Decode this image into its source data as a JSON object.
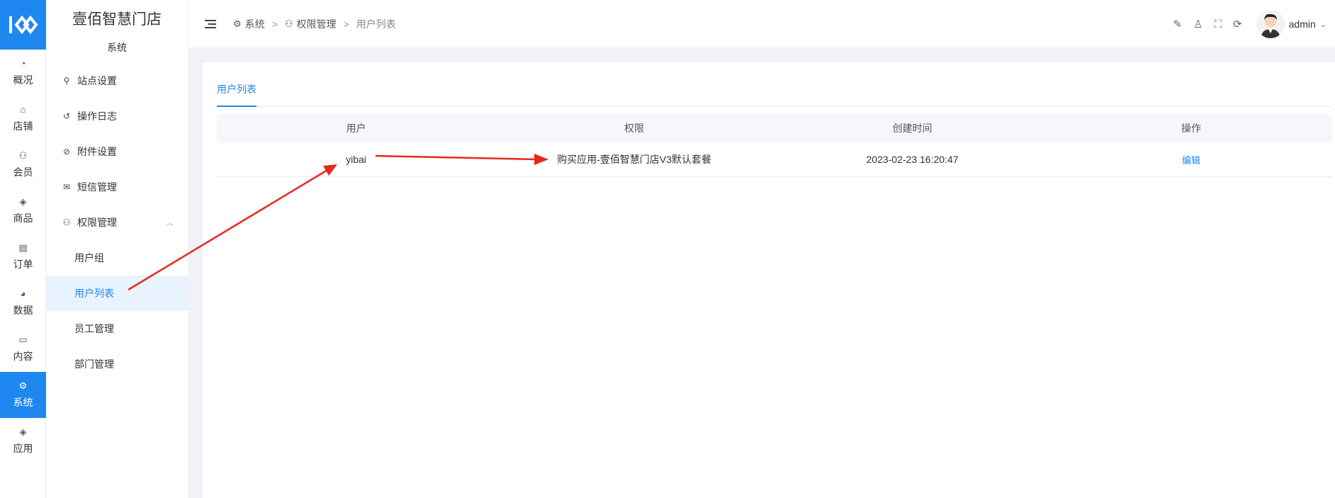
{
  "rail": {
    "items": [
      {
        "label": "概况",
        "icon": "dashboard-icon",
        "glyph": "◔"
      },
      {
        "label": "店铺",
        "icon": "store-icon",
        "glyph": "⌂"
      },
      {
        "label": "会员",
        "icon": "user-icon",
        "glyph": "⚇"
      },
      {
        "label": "商品",
        "icon": "box-icon",
        "glyph": "◈"
      },
      {
        "label": "订单",
        "icon": "clipboard-icon",
        "glyph": "▤"
      },
      {
        "label": "数据",
        "icon": "pie-chart-icon",
        "glyph": "◕"
      },
      {
        "label": "内容",
        "icon": "folder-icon",
        "glyph": "▭"
      },
      {
        "label": "系统",
        "icon": "gear-icon",
        "glyph": "⚙"
      },
      {
        "label": "应用",
        "icon": "cube-icon",
        "glyph": "◈"
      }
    ],
    "active": "系统",
    "accent": "#1e88f0"
  },
  "sidebar": {
    "brand": "壹佰智慧门店",
    "section": "系统",
    "items": [
      {
        "label": "站点设置",
        "icon": "sitemap-icon",
        "glyph": "⚲"
      },
      {
        "label": "操作日志",
        "icon": "history-icon",
        "glyph": "↺"
      },
      {
        "label": "附件设置",
        "icon": "paperclip-icon",
        "glyph": "⊘"
      },
      {
        "label": "短信管理",
        "icon": "mail-icon",
        "glyph": "✉"
      },
      {
        "label": "权限管理",
        "icon": "user-shield-icon",
        "glyph": "⚇"
      }
    ],
    "submenu": [
      "用户组",
      "用户列表",
      "员工管理",
      "部门管理"
    ],
    "active_sub": "用户列表"
  },
  "topbar": {
    "breadcrumb": [
      "系统",
      "权限管理",
      "用户列表"
    ],
    "separator": ">",
    "username": "admin"
  },
  "content": {
    "tab": "用户列表",
    "columns": [
      "用户",
      "权限",
      "创建时间",
      "操作"
    ],
    "rows": [
      {
        "user": "yibai",
        "permission": "购买应用-壹佰智慧门店V3默认套餐",
        "created": "2023-02-23 16:20:47",
        "action": "编辑"
      }
    ]
  },
  "annotation_color": "#e8281f"
}
